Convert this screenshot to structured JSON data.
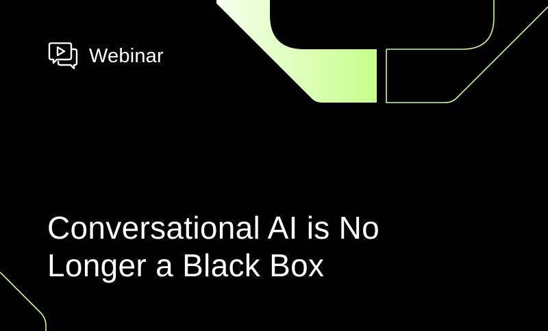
{
  "label": {
    "icon": "video-chat-icon",
    "text": "Webinar"
  },
  "headline": {
    "line1": "Conversational AI is No",
    "line2": "Longer a Black Box"
  },
  "colors": {
    "background": "#000000",
    "text": "#ffffff",
    "accent": "#c8ff8c",
    "accent_light": "#f2ffe4"
  }
}
